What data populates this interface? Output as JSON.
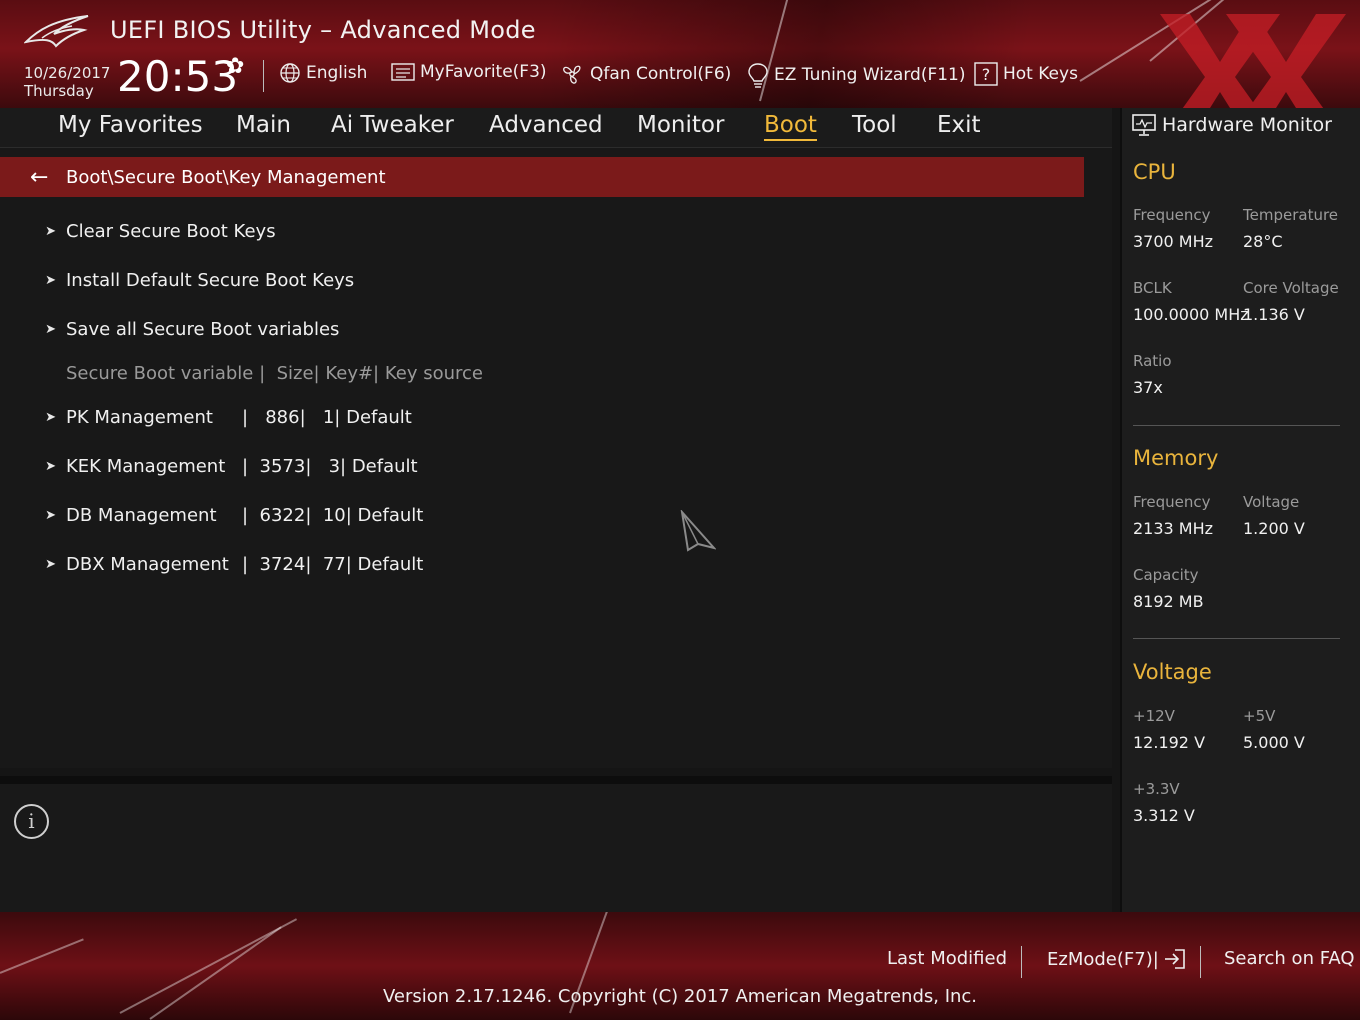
{
  "app": {
    "title": "UEFI BIOS Utility – Advanced Mode",
    "date": "10/26/2017",
    "day": "Thursday",
    "time": "20:53"
  },
  "toolbar": {
    "language": "English",
    "my_favorite": "MyFavorite(F3)",
    "qfan": "Qfan Control(F6)",
    "ez_tuning": "EZ Tuning Wizard(F11)",
    "hot_keys": "Hot Keys"
  },
  "nav": {
    "items": [
      "My Favorites",
      "Main",
      "Ai Tweaker",
      "Advanced",
      "Monitor",
      "Boot",
      "Tool",
      "Exit"
    ],
    "active": "Boot"
  },
  "breadcrumb": "Boot\\Secure Boot\\Key Management",
  "menu": {
    "clear_keys": "Clear Secure Boot Keys",
    "install_keys": "Install Default Secure Boot Keys",
    "save_vars": "Save all Secure Boot variables",
    "table_header": "Secure Boot variable |  Size| Key#| Key source",
    "rows": [
      {
        "name": "PK Management",
        "size": "886",
        "keys": "1",
        "source": "Default"
      },
      {
        "name": "KEK Management",
        "size": "3573",
        "keys": "3",
        "source": "Default"
      },
      {
        "name": "DB Management",
        "size": "6322",
        "keys": "10",
        "source": "Default"
      },
      {
        "name": "DBX Management",
        "size": "3724",
        "keys": "77",
        "source": "Default"
      }
    ]
  },
  "hardware_monitor": {
    "title": "Hardware Monitor",
    "cpu": {
      "heading": "CPU",
      "frequency_label": "Frequency",
      "frequency": "3700 MHz",
      "temperature_label": "Temperature",
      "temperature": "28°C",
      "bclk_label": "BCLK",
      "bclk": "100.0000 MHz",
      "core_voltage_label": "Core Voltage",
      "core_voltage": "1.136 V",
      "ratio_label": "Ratio",
      "ratio": "37x"
    },
    "memory": {
      "heading": "Memory",
      "frequency_label": "Frequency",
      "frequency": "2133 MHz",
      "voltage_label": "Voltage",
      "voltage": "1.200 V",
      "capacity_label": "Capacity",
      "capacity": "8192 MB"
    },
    "voltage": {
      "heading": "Voltage",
      "v12_label": "+12V",
      "v12": "12.192 V",
      "v5_label": "+5V",
      "v5": "5.000 V",
      "v33_label": "+3.3V",
      "v33": "3.312 V"
    }
  },
  "footer": {
    "last_modified": "Last Modified",
    "ezmode": "EzMode(F7)|",
    "search_faq": "Search on FAQ",
    "copyright": "Version 2.17.1246. Copyright (C) 2017 American Megatrends, Inc."
  },
  "colors": {
    "accent": "#f1b93a",
    "breadcrumb_bg": "#7b1a1a",
    "header_red": "#7a1218"
  }
}
